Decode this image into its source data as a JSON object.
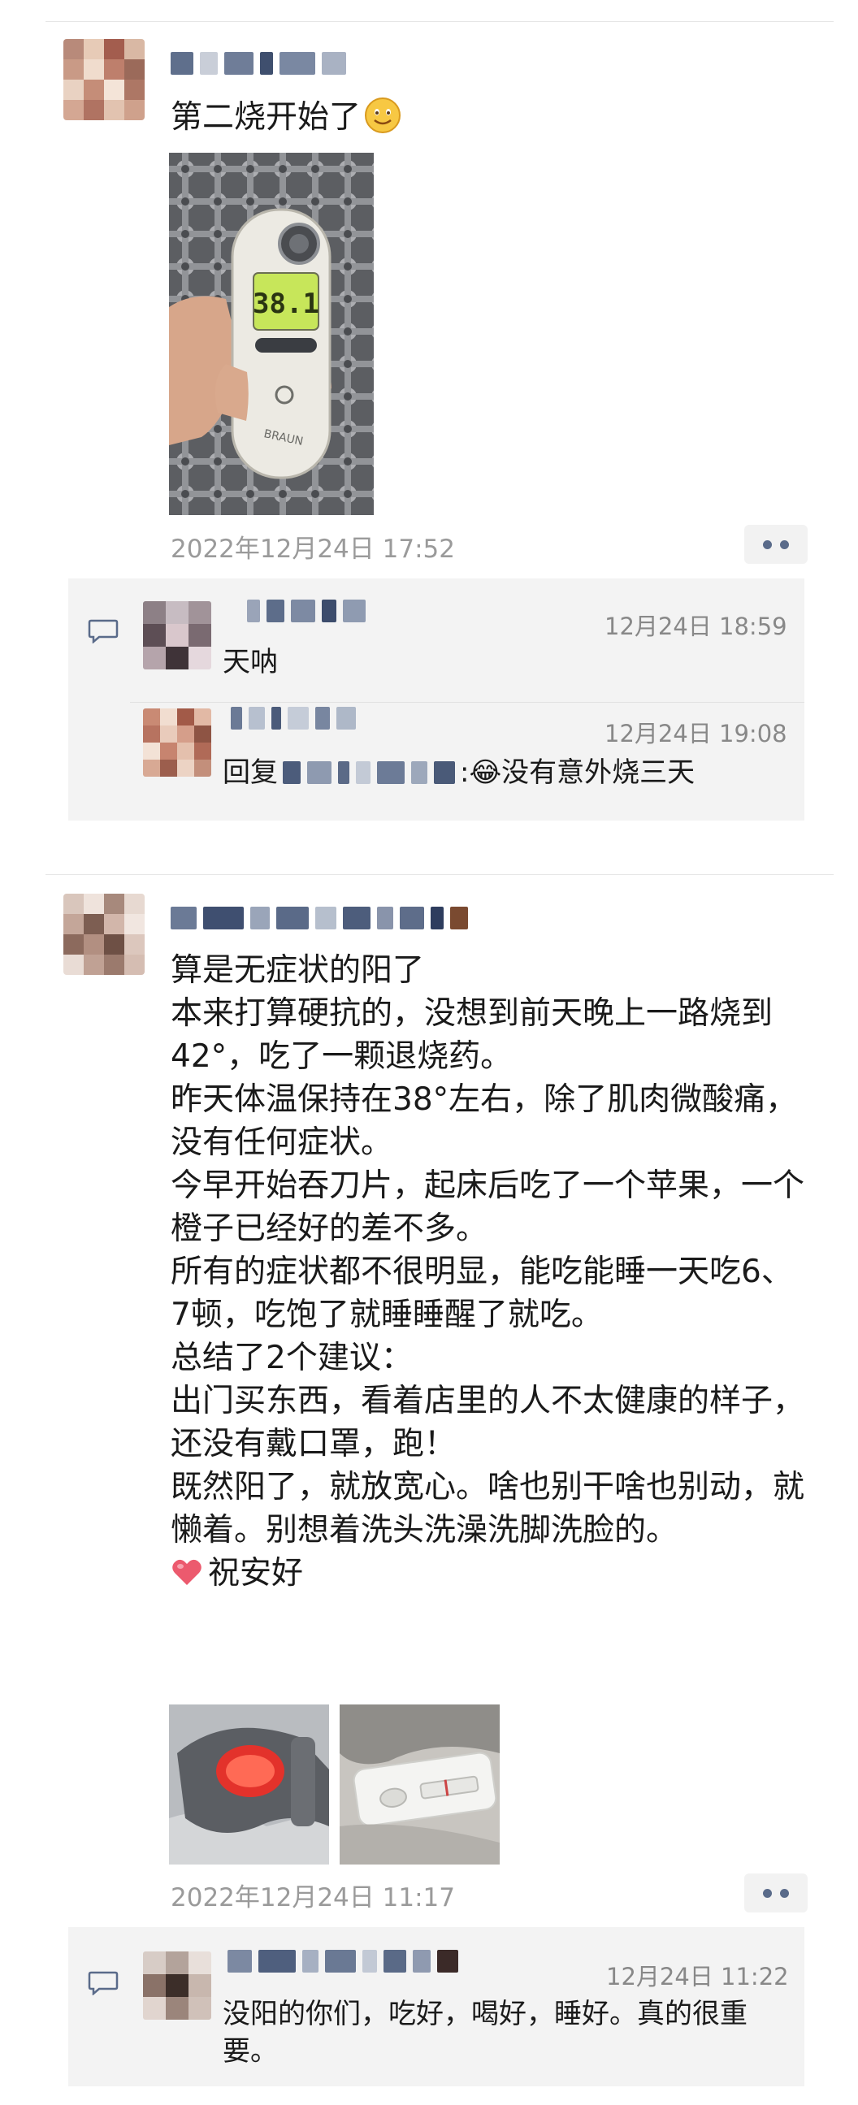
{
  "post1": {
    "text": "第二烧开始了",
    "emoji": "smile-emoji",
    "timestamp": "2022年12月24日 17:52",
    "comments": [
      {
        "date": "12月24日 18:59",
        "text": "天呐"
      },
      {
        "date": "12月24日 19:08",
        "reply_prefix": "回复",
        "text": ":😂没有意外烧三天"
      }
    ]
  },
  "post2": {
    "lines": [
      "算是无症状的阳了",
      "本来打算硬抗的，没想到前天晚上一路烧到42°，吃了一颗退烧药。",
      "昨天体温保持在38°左右，除了肌肉微酸痛，没有任何症状。",
      "今早开始吞刀片，起床后吃了一个苹果，一个橙子已经好的差不多。",
      "所有的症状都不很明显，能吃能睡一天吃6、7顿，吃饱了就睡睡醒了就吃。",
      "总结了2个建议：",
      "出门买东西，看着店里的人不太健康的样子，还没有戴口罩，跑！",
      "既然阳了，就放宽心。啥也别干啥也别动，就懒着。别想着洗头洗澡洗脚洗脸的。"
    ],
    "closing": "祝安好",
    "timestamp": "2022年12月24日 11:17",
    "comments": [
      {
        "date": "12月24日 11:22",
        "text": "没阳的你们，吃好，喝好，睡好。真的很重要。"
      }
    ]
  },
  "thermometer_reading": "38.1",
  "thermometer_brand": "BRAUN",
  "icons": {
    "more": "more-dots-icon",
    "comment": "comment-bubble-icon",
    "heart": "heart-emoji"
  },
  "colors": {
    "link_blue": "#5a6b8a",
    "timestamp_gray": "#9a9a9a",
    "comment_bg": "#f3f3f3"
  }
}
